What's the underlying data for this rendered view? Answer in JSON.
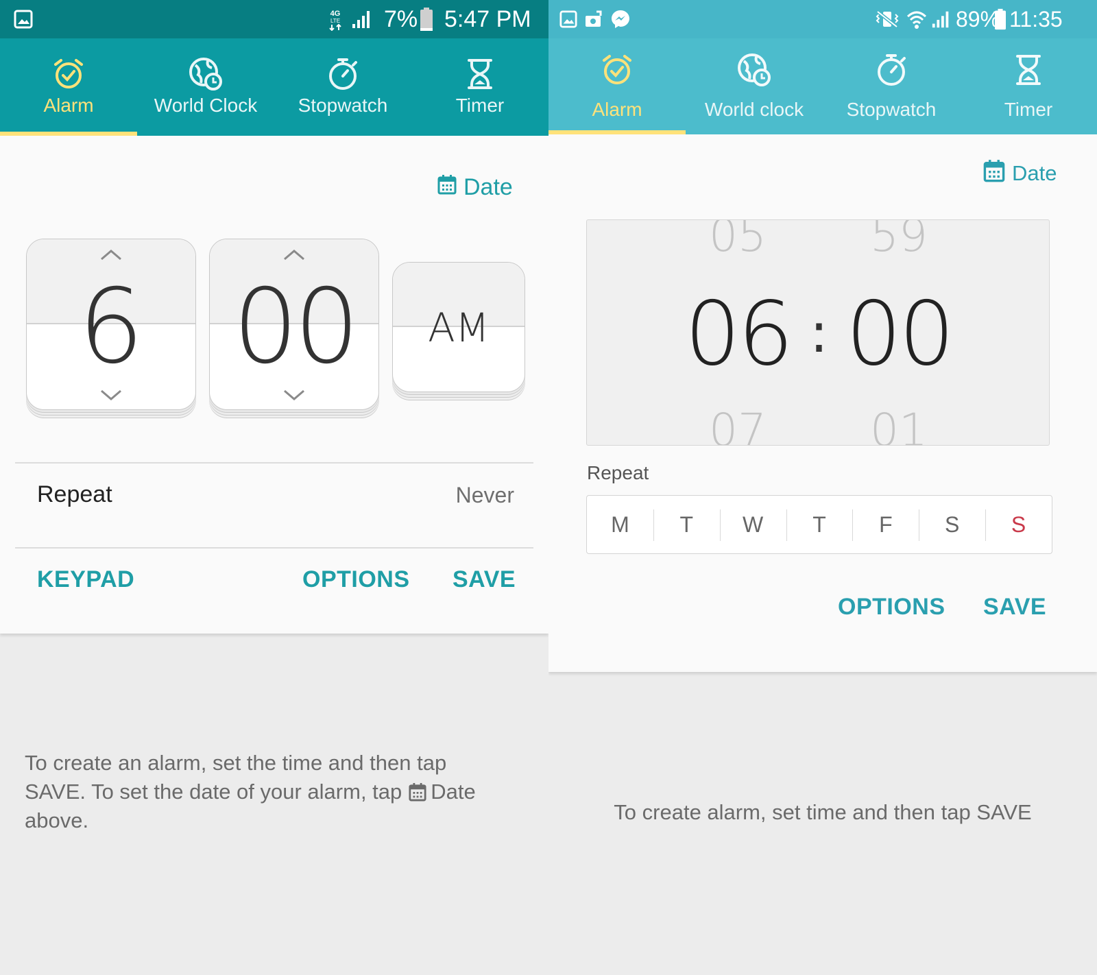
{
  "left": {
    "status": {
      "network": "4G LTE",
      "battery": "7%",
      "time": "5:47 PM"
    },
    "tabs": [
      {
        "label": "Alarm",
        "icon": "alarm-clock-icon",
        "active": true
      },
      {
        "label": "World Clock",
        "icon": "globe-clock-icon",
        "active": false
      },
      {
        "label": "Stopwatch",
        "icon": "stopwatch-icon",
        "active": false
      },
      {
        "label": "Timer",
        "icon": "hourglass-icon",
        "active": false
      }
    ],
    "date_label": "Date",
    "hour": "6",
    "minute": "00",
    "ampm": "AM",
    "repeat_label": "Repeat",
    "repeat_value": "Never",
    "keypad": "KEYPAD",
    "options": "OPTIONS",
    "save": "SAVE",
    "hint_line1": "To create an alarm, set the time and then tap",
    "hint_line2a": "SAVE. To set the date of your alarm, tap",
    "hint_line2b": "Date",
    "hint_line3": "above."
  },
  "right": {
    "status": {
      "battery": "89%",
      "time": "11:35"
    },
    "tabs": [
      {
        "label": "Alarm",
        "icon": "alarm-clock-icon",
        "active": true
      },
      {
        "label": "World clock",
        "icon": "globe-clock-icon",
        "active": false
      },
      {
        "label": "Stopwatch",
        "icon": "stopwatch-icon",
        "active": false
      },
      {
        "label": "Timer",
        "icon": "hourglass-icon",
        "active": false
      }
    ],
    "date_label": "Date",
    "hour_prev": "05",
    "hour": "06",
    "hour_next": "07",
    "minute_prev": "59",
    "minute": "00",
    "minute_next": "01",
    "separator": ":",
    "repeat_label": "Repeat",
    "days": [
      "M",
      "T",
      "W",
      "T",
      "F",
      "S",
      "S"
    ],
    "options": "OPTIONS",
    "save": "SAVE",
    "hint": "To create alarm, set time and then tap SAVE"
  },
  "colors": {
    "left_accent": "#0c9ba2",
    "right_accent": "#4cbccc",
    "active_tab": "#ffe27a",
    "sunday": "#c9394a",
    "action": "#1f9ea6"
  }
}
